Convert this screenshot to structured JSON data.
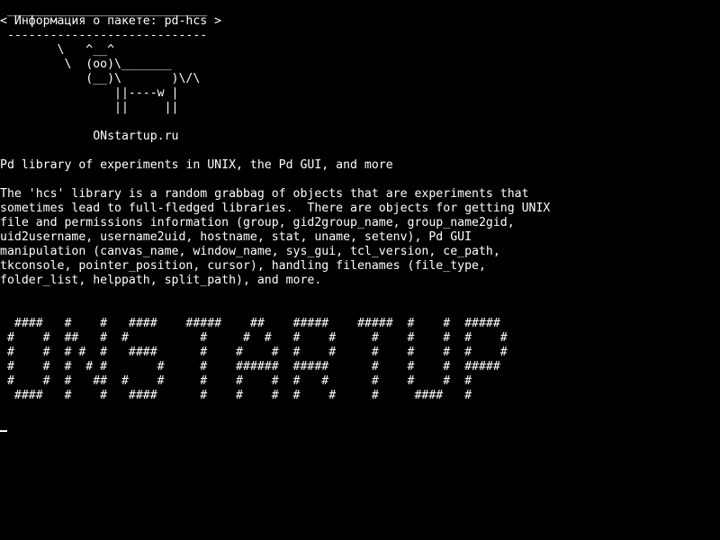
{
  "terminal": {
    "bubble": [
      " ____________________________",
      "< Информация о пакете: pd-hcs >",
      " ----------------------------"
    ],
    "cow": [
      "        \\   ^__^",
      "         \\  (oo)\\_______",
      "            (__)\\       )\\/\\",
      "                ||----w |",
      "                ||     ||"
    ],
    "site": "             ONstartup.ru",
    "summary": "Pd library of experiments in UNIX, the Pd GUI, and more",
    "description": [
      "The 'hcs' library is a random grabbag of objects that are experiments that",
      "sometimes lead to full-fledged libraries.  There are objects for getting UNIX",
      "file and permissions information (group, gid2group_name, group_name2gid,",
      "uid2username, username2uid, hostname, stat, uname, setenv), Pd GUI",
      "manipulation (canvas_name, window_name, sys_gui, tcl_version, ce_path,",
      "tkconsole, pointer_position, cursor), handling filenames (file_type,",
      "folder_list, helppath, split_path), and more."
    ],
    "banner": [
      "  ####   #    #   ####    #####    ##    #####    #####  #    #  #####",
      " #    #  ##   #  #          #     #  #   #    #     #    #    #  #    #",
      " #    #  # #  #   ####      #    #    #  #    #     #    #    #  #    #",
      " #    #  #  # #       #     #    ######  #####      #    #    #  #####",
      " #    #  #   ##  #    #     #    #    #  #   #      #    #    #  #",
      "  ####   #    #   ####      #    #    #  #    #     #     ####   #"
    ]
  },
  "colors": {
    "background": "#000000",
    "foreground": "#ffffff"
  }
}
